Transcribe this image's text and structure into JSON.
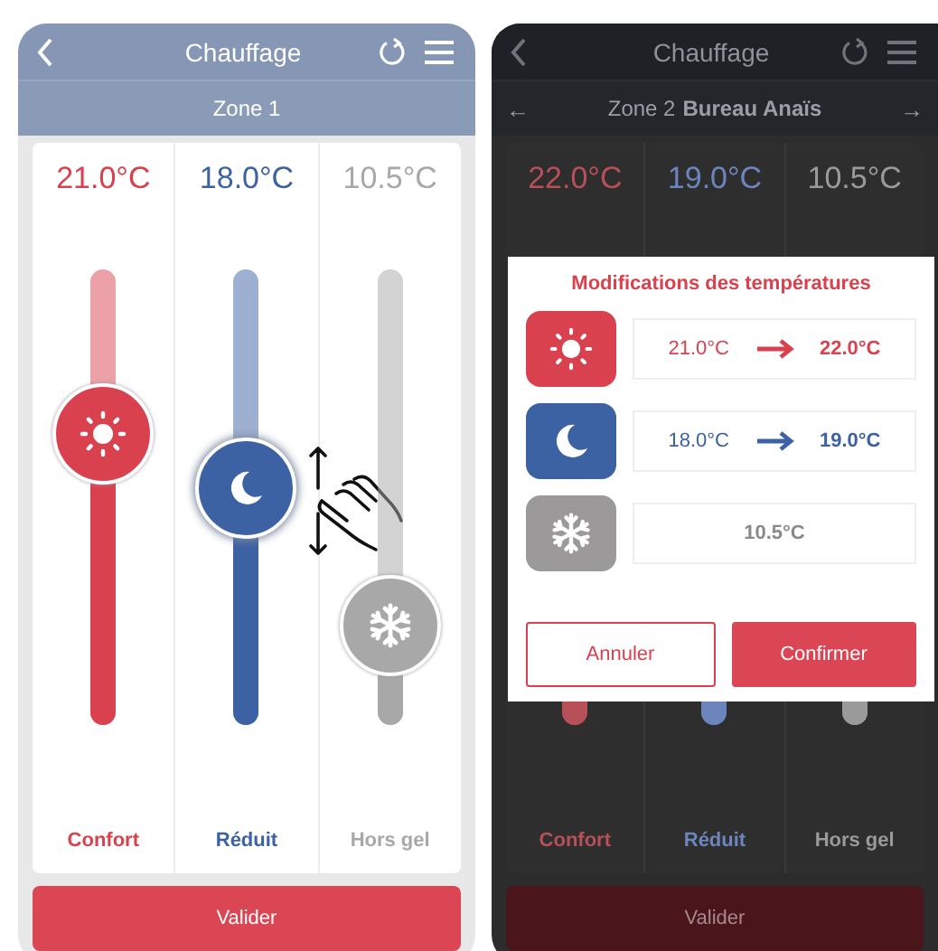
{
  "screens": [
    {
      "dimmed": false,
      "title": "Chauffage",
      "zone": {
        "label": "Zone 1"
      },
      "modes": [
        {
          "kind": "comfort",
          "temperature": "21.0°C",
          "label": "Confort",
          "color": "#d9414f",
          "level": 0.64,
          "dragging": false
        },
        {
          "kind": "eco",
          "temperature": "18.0°C",
          "label": "Réduit",
          "color": "#3d62a3",
          "level": 0.52,
          "dragging": true
        },
        {
          "kind": "frost",
          "temperature": "10.5°C",
          "label": "Hors gel",
          "color": "#a8a8a8",
          "level": 0.22,
          "dragging": false
        }
      ],
      "submit": "Valider"
    },
    {
      "dimmed": true,
      "title": "Chauffage",
      "zone": {
        "prev": "←",
        "label": "Zone 2",
        "name": "Bureau Anaïs",
        "next": "→"
      },
      "modes": [
        {
          "kind": "comfort",
          "temperature": "22.0°C",
          "label": "Confort"
        },
        {
          "kind": "eco",
          "temperature": "19.0°C",
          "label": "Réduit"
        },
        {
          "kind": "frost",
          "temperature": "10.5°C",
          "label": "Hors gel"
        }
      ],
      "submit": "Valider",
      "dialog": {
        "title": "Modifications des températures",
        "changes": [
          {
            "kind": "comfort",
            "color": "#d9414f",
            "from": "21.0°C",
            "to": "22.0°C"
          },
          {
            "kind": "eco",
            "color": "#3d62a3",
            "from": "18.0°C",
            "to": "19.0°C"
          },
          {
            "kind": "frost",
            "color": "#9b9999",
            "to": "10.5°C"
          }
        ],
        "cancel": "Annuler",
        "confirm": "Confirmer"
      }
    }
  ]
}
